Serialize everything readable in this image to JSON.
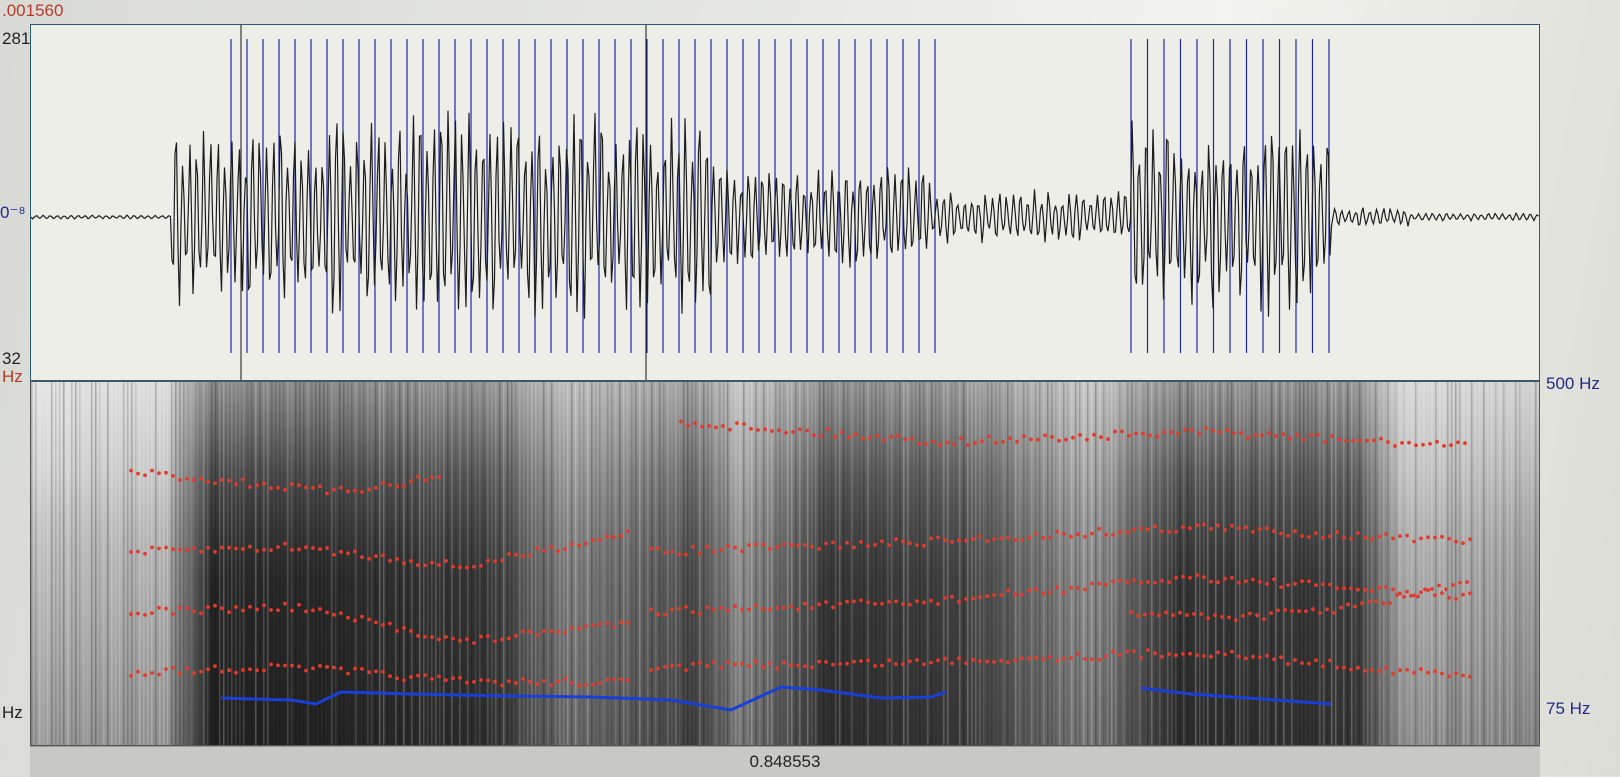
{
  "waveform": {
    "cursor_time_label": ".001560",
    "amplitude_max_label": "281",
    "amplitude_zero_label": "0⁻⁸",
    "amplitude_min_label": "32"
  },
  "spectrogram": {
    "freq_max_left_label": "Hz",
    "freq_max_right_label": "500 Hz",
    "freq_min_left_label": "Hz",
    "freq_min_right_label": "75 Hz"
  },
  "time_bar": {
    "cursor_time": "0.848553"
  },
  "colors": {
    "waveform_line": "#1d1d1d",
    "pulse_marks": "#1f2a9a",
    "formant_dots": "#e53a2a",
    "pitch_track": "#1a3fd6",
    "label_red": "#b53b2a",
    "label_blue": "#1f2a8a"
  }
}
